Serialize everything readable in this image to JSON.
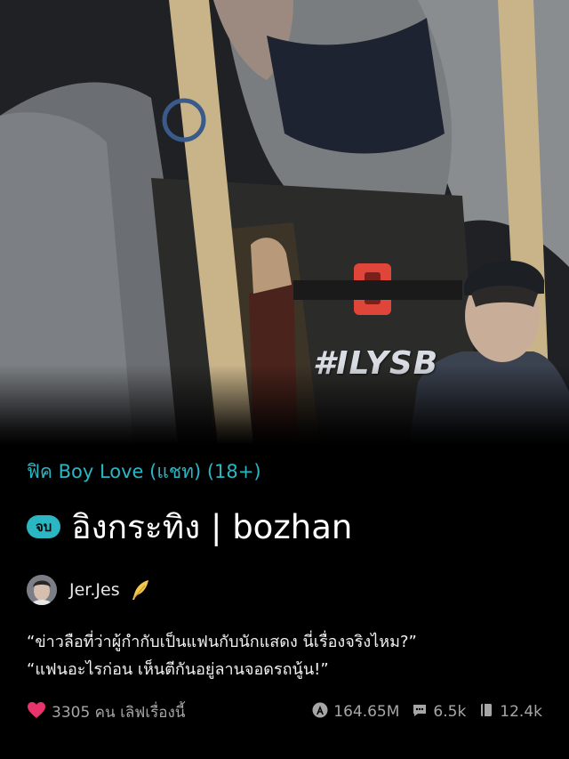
{
  "cover": {
    "hashtag": "#ILYSB"
  },
  "category": "ฟิค Boy Love (แชท) (18+)",
  "status_badge": "จบ",
  "title": "อิงกระทิง | bozhan",
  "author": {
    "name": "Jer.Jes",
    "badge_icon": "feather-icon"
  },
  "blurb": [
    "“ข่าวลือที่ว่าผู้กำกับเป็นแฟนกับนักแสดง นี่เรื่องจริงไหม?”",
    "“แฟนอะไรก่อน เห็นตีกันอยู่ลานจอดรถนู้น!”"
  ],
  "stats": {
    "likes_label": "3305 คน เลิฟเรื่องนี้",
    "views": "164.65M",
    "comments": "6.5k",
    "chapters": "12.4k"
  },
  "colors": {
    "accent": "#2bb6c4",
    "heart": "#e8336d",
    "muted": "#a6a6a6"
  }
}
